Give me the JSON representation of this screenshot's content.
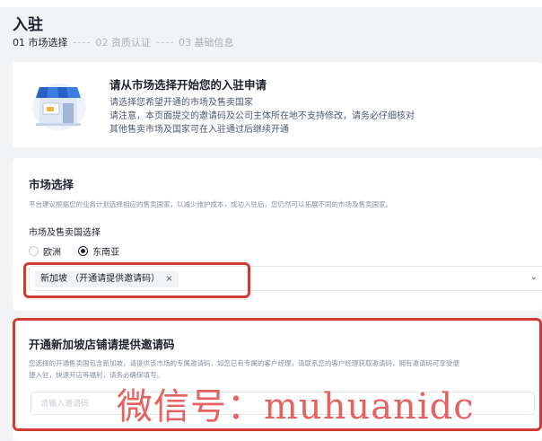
{
  "page": {
    "title": "入驻"
  },
  "steps": [
    {
      "label": "01 市场选择",
      "state": "active"
    },
    {
      "label": "02 资质认证",
      "state": "inactive"
    },
    {
      "label": "03 基础信息",
      "state": "inactive"
    }
  ],
  "intro": {
    "icon": "storefront-icon",
    "title": "请从市场选择开始您的入驻申请",
    "lines": [
      "请选择您希望开通的市场及售卖国家",
      "请注意，本页面提交的邀请码及公司主体所在地不支持修改，请务必仔细核对",
      "其他售卖市场及国家可在入驻通过后继续开通"
    ]
  },
  "market": {
    "title": "市场选择",
    "description": "平台建议根据您的业务计划选择相应的售卖国家，以减少维护成本，成功入驻后，您仍然可以拓展不同的市场及售卖国家。",
    "field_label": "市场及售卖国选择",
    "radios": [
      {
        "label": "欧洲",
        "checked": false
      },
      {
        "label": "东南亚",
        "checked": true
      }
    ],
    "selected_tags": [
      "新加坡 （开通请提供邀请码）"
    ],
    "tag_close_glyph": "×",
    "dropdown_glyph": "⌄"
  },
  "invite": {
    "title": "开通新加坡店铺请提供邀请码",
    "description_lines": [
      "您选择的开通售卖国包含新加坡，请提供该市场的专属邀请码，如您已有专属的客户经理，请联系您的客户经理获取邀请码，拥有邀请码可享受便",
      "捷入驻，快速开店等福利，请务必确保填写。"
    ],
    "input_value": "",
    "input_placeholder": "请输入邀请码"
  },
  "watermark": "微信号：muhuanidc",
  "colors": {
    "background": "#f2f3f5",
    "card": "#ffffff",
    "highlight_border": "#d23a30",
    "watermark": "#e14646"
  }
}
